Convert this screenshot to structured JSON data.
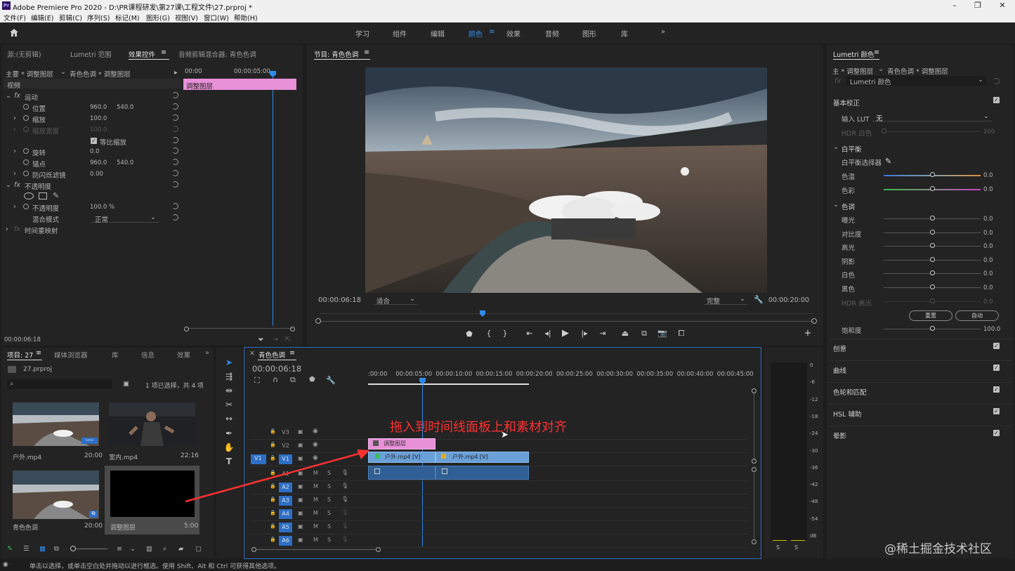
{
  "app": {
    "title": "Adobe Premiere Pro 2020 - D:\\PR课程研发\\第27课\\工程文件\\27.prproj *",
    "logo": "Pr"
  },
  "menu": [
    "文件(F)",
    "编辑(E)",
    "剪辑(C)",
    "序列(S)",
    "标记(M)",
    "图形(G)",
    "视图(V)",
    "窗口(W)",
    "帮助(H)"
  ],
  "workspaces": {
    "items": [
      "学习",
      "组件",
      "编辑",
      "颜色",
      "效果",
      "音频",
      "图形",
      "库"
    ],
    "active": "颜色",
    "more": "»"
  },
  "effects_panel": {
    "tabs": [
      "源:(无剪辑)",
      "Lumetri 范围",
      "效果控件",
      "音频剪辑混合器: 青色色调"
    ],
    "master": "主要 * 调整图层",
    "seq": "青色色调 * 调整图层",
    "ruler": [
      "00:00",
      "00:00:05:00"
    ],
    "clip_label": "调整图层",
    "video": "视频",
    "motion": "运动",
    "props": [
      {
        "label": "位置",
        "v1": "960.0",
        "v2": "540.0"
      },
      {
        "label": "缩放",
        "v1": "100.0",
        "v2": ""
      },
      {
        "label": "缩放宽度",
        "v1": "100.0",
        "v2": ""
      },
      {
        "label": "等比缩放",
        "v1": "",
        "v2": ""
      },
      {
        "label": "旋转",
        "v1": "0.0",
        "v2": ""
      },
      {
        "label": "锚点",
        "v1": "960.0",
        "v2": "540.0"
      },
      {
        "label": "防闪烁滤镜",
        "v1": "0.00",
        "v2": ""
      }
    ],
    "opacity": "不透明度",
    "opacity_prop": {
      "label": "不透明度",
      "value": "100.0 %"
    },
    "blend": {
      "label": "混合模式",
      "value": "正常"
    },
    "time_remap": "时间重映射",
    "timecode": "00:00:06:18"
  },
  "program": {
    "title": "节目: 青色色调",
    "timecode": "00:00:06:18",
    "fit": "适合",
    "quality": "完整",
    "duration": "00:00:20:00",
    "buttons": [
      "marker",
      "in",
      "out",
      "go-in",
      "step-back",
      "play",
      "step-fwd",
      "go-out",
      "lift",
      "extract",
      "camera",
      "compare",
      "add"
    ]
  },
  "project": {
    "tabs": [
      "项目: 27",
      "媒体浏览器",
      "库",
      "信息",
      "效果"
    ],
    "file": "27.prproj",
    "count": "1 项已选择，共 4 项",
    "items": [
      {
        "name": "户外.mp4",
        "dur": "20:00"
      },
      {
        "name": "室内.mp4",
        "dur": "22:16"
      },
      {
        "name": "青色色调",
        "dur": "20:00"
      },
      {
        "name": "调整图层",
        "dur": "5:00"
      }
    ]
  },
  "timeline": {
    "title": "青色色调",
    "timecode": "00:00:06:18",
    "ruler": [
      ":00:00",
      "00:00:05:00",
      "00:00:10:00",
      "00:00:15:00",
      "00:00:20:00",
      "00:00:25:00",
      "00:00:30:00",
      "00:00:35:00",
      "00:00:40:00",
      "00:00:45:00"
    ],
    "tracks": [
      "V3",
      "V2",
      "V1",
      "A1",
      "A2",
      "A3",
      "A4",
      "A5",
      "A6"
    ],
    "clips": {
      "adjust": "调整图层",
      "v1a": "户外.mp4 [V]",
      "v1b": "户外.mp4 [V]"
    },
    "annotation": "拖入到时间线面板上和素材对齐"
  },
  "meter": {
    "scale": [
      "0",
      "-6",
      "-12",
      "-18",
      "-24",
      "-30",
      "-36",
      "-42",
      "-48",
      "-54",
      "dB"
    ],
    "solo": [
      "S",
      "S"
    ]
  },
  "lumetri": {
    "title": "Lumetri 颜色",
    "master": "主 * 调整图层",
    "seq": "青色色调 * 调整图层",
    "effect": "Lumetri 颜色",
    "basic": "基本校正",
    "lut_label": "输入 LUT",
    "lut_value": "无",
    "hdr_white": "HDR 白色",
    "hdr_value": "100",
    "wb": "白平衡",
    "wb_selector": "白平衡选择器",
    "temp": {
      "label": "色温",
      "value": "0.0"
    },
    "tint": {
      "label": "色彩",
      "value": "0.0"
    },
    "tone": "色调",
    "tone_rows": [
      {
        "label": "曝光",
        "value": "0.0"
      },
      {
        "label": "对比度",
        "value": "0.0"
      },
      {
        "label": "高光",
        "value": "0.0"
      },
      {
        "label": "阴影",
        "value": "0.0"
      },
      {
        "label": "白色",
        "value": "0.0"
      },
      {
        "label": "黑色",
        "value": "0.0"
      },
      {
        "label": "HDR 高光",
        "value": "0.0"
      }
    ],
    "reset": "重置",
    "auto": "自动",
    "saturation": {
      "label": "饱和度",
      "value": "100.0"
    },
    "sections": [
      "创意",
      "曲线",
      "色轮和匹配",
      "HSL 辅助",
      "晕影"
    ]
  },
  "status": "单击以选择，或单击空白处并拖动以进行框选。使用 Shift、Alt 和 Ctrl 可获得其他选项。",
  "watermark": "@稀土掘金技术社区"
}
